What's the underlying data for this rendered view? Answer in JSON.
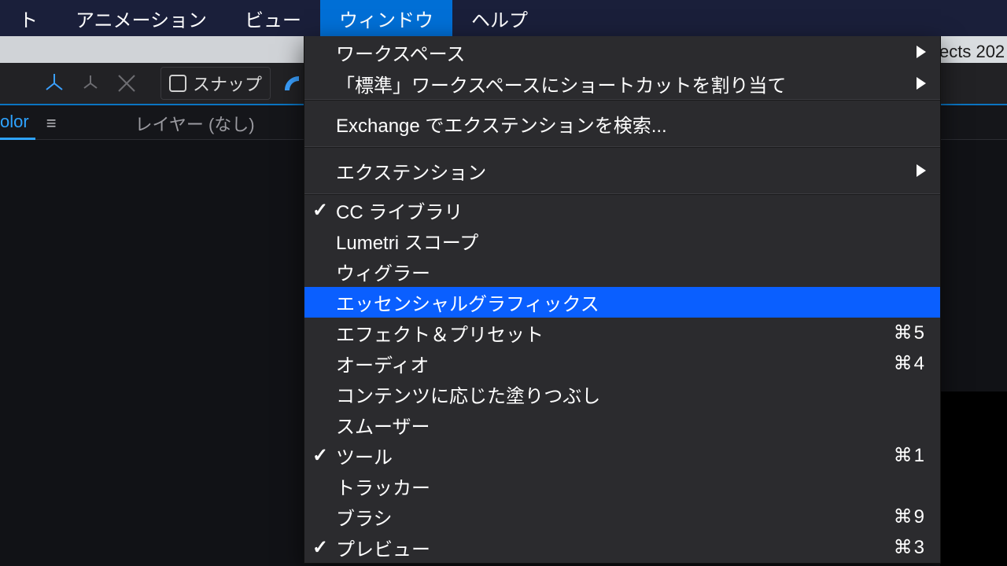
{
  "menubar": {
    "items": [
      {
        "label": "ト"
      },
      {
        "label": "アニメーション"
      },
      {
        "label": "ビュー"
      },
      {
        "label": "ウィンドウ",
        "active": true
      },
      {
        "label": "ヘルプ"
      }
    ]
  },
  "title_fragment": "ects 202",
  "toolbar": {
    "snap_label": "スナップ"
  },
  "panel": {
    "active_tab": "olor",
    "layer_label": "レイヤー (なし)"
  },
  "dropdown": {
    "group1": [
      {
        "label": "ワークスペース",
        "submenu": true
      },
      {
        "label": "「標準」ワークスペースにショートカットを割り当て",
        "submenu": true
      }
    ],
    "group2": [
      {
        "label": "Exchange でエクステンションを検索..."
      }
    ],
    "group3": [
      {
        "label": "エクステンション",
        "submenu": true
      }
    ],
    "group4": [
      {
        "label": "CC ライブラリ",
        "checked": true
      },
      {
        "label": "Lumetri スコープ"
      },
      {
        "label": "ウィグラー"
      },
      {
        "label": "エッセンシャルグラフィックス",
        "highlight": true
      },
      {
        "label": "エフェクト＆プリセット",
        "shortcut": "⌘5"
      },
      {
        "label": "オーディオ",
        "shortcut": "⌘4"
      },
      {
        "label": "コンテンツに応じた塗りつぶし"
      },
      {
        "label": "スムーザー"
      },
      {
        "label": "ツール",
        "checked": true,
        "shortcut": "⌘1"
      },
      {
        "label": "トラッカー"
      },
      {
        "label": "ブラシ",
        "shortcut": "⌘9"
      },
      {
        "label": "プレビュー",
        "checked": true,
        "shortcut": "⌘3"
      }
    ]
  }
}
